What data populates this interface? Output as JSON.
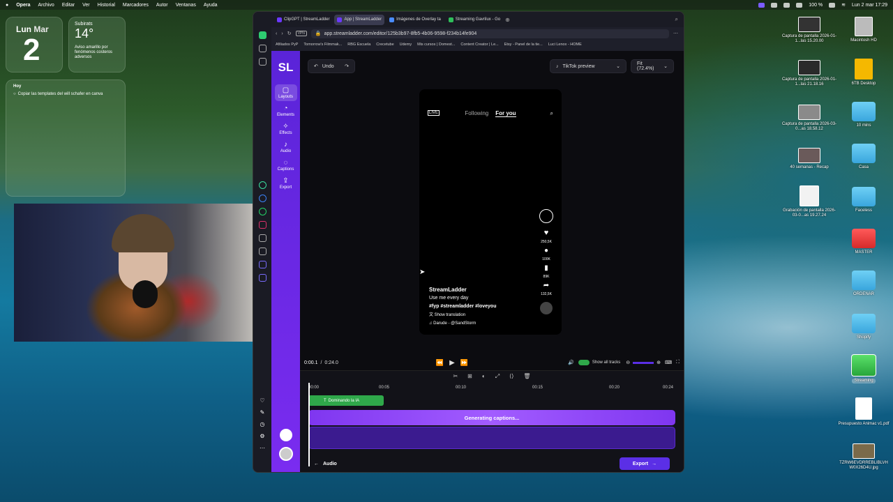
{
  "menubar": {
    "apple": "",
    "app": "Opera",
    "items": [
      "Archivo",
      "Editar",
      "Ver",
      "Historial",
      "Marcadores",
      "Autor",
      "Ventanas",
      "Ayuda"
    ],
    "battery": "100 %",
    "datetime": "Lun 2 mar 17:29"
  },
  "widgets": {
    "date_day": "Lun",
    "date_month": "Mar",
    "date_num": "2",
    "weather_loc": "Subirats",
    "weather_temp": "14°",
    "weather_alert": "Aviso amarillo por fenómenos costeros adversos",
    "reminder_title": "Hoy",
    "reminder_item": "Copiar las templates del will schafer en canva"
  },
  "browser": {
    "tabs": [
      {
        "label": "ClipGPT | StreamLadder"
      },
      {
        "label": "App | StreamLadder"
      },
      {
        "label": "Imágenes de Overlay ta"
      },
      {
        "label": "Streaming Gavrilux - Go"
      }
    ],
    "url": "app.streamladder.com/editor/125b3b97-8fb5-4b06-9598-f234b14fe904",
    "bookmarks": [
      "Afiliados PyP",
      "Tomorrow's Filmmak...",
      "RBG Escuela",
      "Crecetube",
      "Udemy",
      "Mis cursos | Domest...",
      "Content Creator | Le...",
      "Etsy - Panel de la tie...",
      "Luci Lenox - HOME"
    ]
  },
  "app": {
    "logo": "SL",
    "nav": [
      {
        "label": "Layouts"
      },
      {
        "label": "Elements"
      },
      {
        "label": "Effects"
      },
      {
        "label": "Audio"
      },
      {
        "label": "Captions"
      },
      {
        "label": "Export"
      }
    ],
    "undo": "Undo",
    "preview_select": "TikTok preview",
    "fit_select": "Fit (72.4%)",
    "tiktok": {
      "following": "Following",
      "foryou": "For you",
      "likes": "250,5K",
      "comments": "100K",
      "saves": "89K",
      "shares": "132,5K",
      "username": "StreamLadder",
      "caption": "Use me every day",
      "hashtags": "#fyp #streamladder #loveyou",
      "translation": "Show translation",
      "sound": "Darude - @SandStorm",
      "live": "LIVE"
    },
    "time_current": "0:00.1",
    "time_sep": "/",
    "time_total": "0:24.0",
    "show_tracks": "Show all tracks",
    "ruler": [
      "00:00",
      "00:05",
      "00:10",
      "00:15",
      "00:20",
      "00:24"
    ],
    "clip_label": "Dominando la IA",
    "generating": "Generating captions...",
    "back_label": "Audio",
    "export_label": "Export"
  },
  "desktop": [
    {
      "label": "Captura de pantalla 2026-01-1...las 15.20.00",
      "kind": "thumb"
    },
    {
      "label": "Macintosh HD",
      "kind": "disk"
    },
    {
      "label": "Captura de pantalla 2026-01-1...las 21.18.16",
      "kind": "thumb"
    },
    {
      "label": "6TB Desktop",
      "kind": "ydisk"
    },
    {
      "label": "Captura de pantalla 2026-03-0...as 18.58.12",
      "kind": "thumb"
    },
    {
      "label": "10 mins",
      "kind": "folder"
    },
    {
      "label": "40 semanas - Recap",
      "kind": "thumb"
    },
    {
      "label": "Casa",
      "kind": "folder"
    },
    {
      "label": "Grabación de pantalla 2026-03-0...as 19.27.24",
      "kind": "thumb"
    },
    {
      "label": "Faceless",
      "kind": "folder"
    },
    {
      "label": "MASTER",
      "kind": "redfolder"
    },
    {
      "label": "ORDENAR",
      "kind": "folder"
    },
    {
      "label": "Shopify",
      "kind": "folder"
    },
    {
      "label": "Streaming",
      "kind": "greenfolder"
    },
    {
      "label": "Presupuesto Animac v1.pdf",
      "kind": "doc"
    },
    {
      "label": "TZRW6EVDRREBLIBLVH W0X26D4U.jpg",
      "kind": "thumb"
    }
  ]
}
